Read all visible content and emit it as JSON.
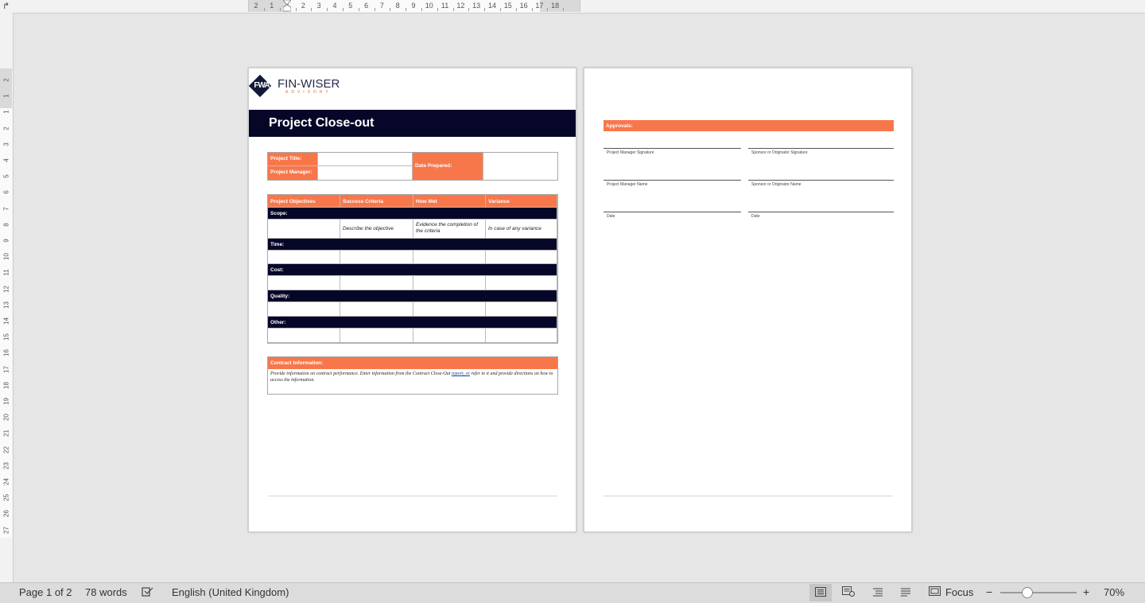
{
  "ruler": {
    "h_numbers": [
      "2",
      "1",
      "1",
      "2",
      "3",
      "4",
      "5",
      "6",
      "7",
      "8",
      "9",
      "10",
      "11",
      "12",
      "13",
      "14",
      "15",
      "16",
      "17",
      "18"
    ],
    "v_numbers": [
      "2",
      "1",
      "1",
      "2",
      "3",
      "4",
      "5",
      "6",
      "7",
      "8",
      "9",
      "10",
      "11",
      "12",
      "13",
      "14",
      "15",
      "16",
      "17",
      "18",
      "19",
      "20",
      "21",
      "22",
      "23",
      "24",
      "25",
      "26",
      "27"
    ]
  },
  "page1": {
    "logo_mark": "FWA",
    "logo_brand": "FIN-WISER",
    "logo_sub": "ADVISORY",
    "title": "Project Close-out",
    "info": {
      "project_title_label": "Project Title:",
      "project_manager_label": "Project Manager:",
      "date_prepared_label": "Date Prepared:"
    },
    "objectives": {
      "headers": [
        "Project Objectives",
        "Success Criteria",
        "How Met",
        "Variance"
      ],
      "sections": [
        {
          "label": "Scope:",
          "row": [
            "",
            "Describe the objective",
            "Evidence the completion of the criteria",
            "In case of any variance"
          ]
        },
        {
          "label": "Time:",
          "row": [
            "",
            "",
            "",
            ""
          ]
        },
        {
          "label": "Cost:",
          "row": [
            "",
            "",
            "",
            ""
          ]
        },
        {
          "label": "Quality:",
          "row": [
            "",
            "",
            "",
            ""
          ]
        },
        {
          "label": "Other:",
          "row": [
            "",
            "",
            "",
            ""
          ]
        }
      ]
    },
    "contract": {
      "header": "Contract Information:",
      "text_before": "Provide information on contract performance. Enter information from the Contract Close-Out ",
      "text_link": "report, or",
      "text_after": " refer to it and provide directions on how to access the information."
    }
  },
  "page2": {
    "approvals_label": "Approvals:",
    "signatures": [
      [
        "Project Manager Signature",
        "Sponsor or Originator Signature"
      ],
      [
        "Project Manager Name",
        "Sponsor or Originator Name"
      ],
      [
        "Date",
        "Date"
      ]
    ]
  },
  "status": {
    "page": "Page 1 of 2",
    "words": "78 words",
    "language": "English (United Kingdom)",
    "focus": "Focus",
    "zoom": "70%",
    "zoom_minus": "−",
    "zoom_plus": "+"
  }
}
